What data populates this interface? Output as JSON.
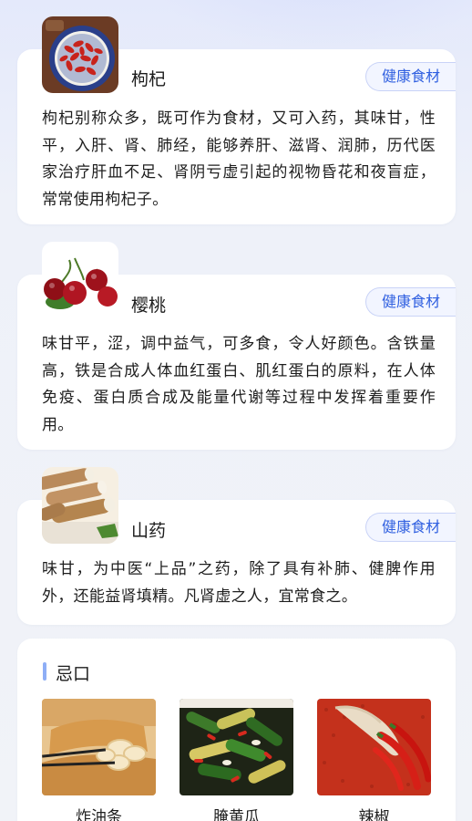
{
  "foods": [
    {
      "name": "枸杞",
      "tag": "健康食材",
      "description": "枸杞别称众多，既可作为食材，又可入药，其味甘，性平，入肝、肾、肺经，能够养肝、滋肾、润肺，历代医家治疗肝血不足、肾阴亏虚引起的视物昏花和夜盲症，常常使用枸杞子。",
      "image_icon": "goji-berries-image"
    },
    {
      "name": "樱桃",
      "tag": "健康食材",
      "description": "味甘平，涩，调中益气，可多食，令人好颜色。含铁量高，铁是合成人体血红蛋白、肌红蛋白的原料，在人体免疫、蛋白质合成及能量代谢等过程中发挥着重要作用。",
      "image_icon": "cherries-image"
    },
    {
      "name": "山药",
      "tag": "健康食材",
      "description": "味甘，为中医“上品”之药，除了具有补肺、健脾作用外，还能益肾填精。凡肾虚之人，宜常食之。",
      "image_icon": "chinese-yam-image"
    }
  ],
  "avoid": {
    "title": "忌口",
    "items": [
      {
        "label": "炸油条",
        "image_icon": "fried-dough-stick-image"
      },
      {
        "label": "腌黄瓜",
        "image_icon": "pickled-cucumber-image"
      },
      {
        "label": "辣椒",
        "image_icon": "chili-pepper-image"
      }
    ]
  },
  "colors": {
    "accent": "#2f5fe0",
    "tag_border": "#c9d3f7",
    "avoid_bar": "#8eaef6"
  }
}
